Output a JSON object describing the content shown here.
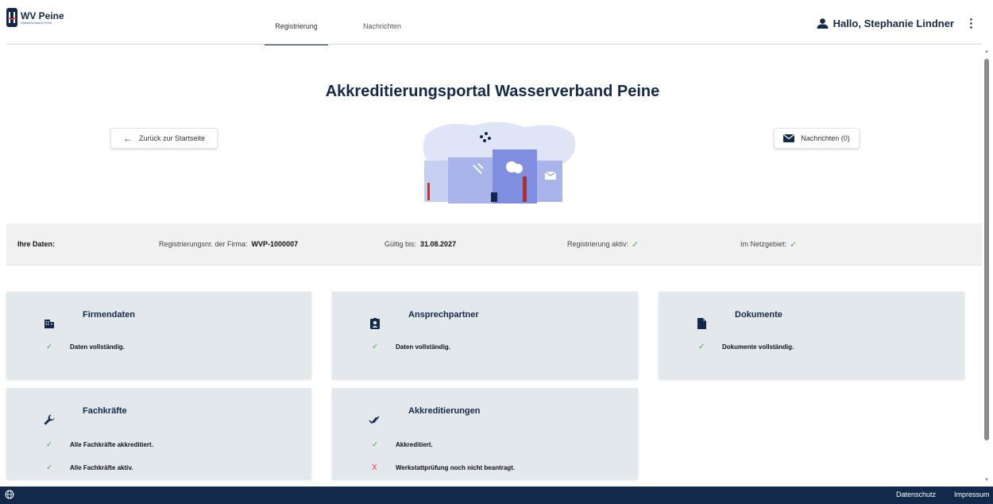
{
  "header": {
    "logo_title": "WV Peine",
    "logo_subtitle": "Wasserverband Peine",
    "tabs": [
      {
        "label": "Registrierung",
        "active": true
      },
      {
        "label": "Nachrichten",
        "active": false
      }
    ],
    "user_greeting": "Hallo, Stephanie Lindner"
  },
  "hero": {
    "title": "Akkreditierungsportal Wasserverband Peine",
    "back_button": "Zurück zur Startseite",
    "messages_button": "Nachrichten (0)"
  },
  "info": {
    "label": "Ihre Daten:",
    "reg_label": "Registrierungsnr. der Firma:",
    "reg_value": "WVP-1000007",
    "valid_label": "Gültig bis:",
    "valid_value": "31.08.2027",
    "active_label": "Registrierung aktiv:",
    "network_label": "Im Netzgebiet:",
    "check": "✓"
  },
  "cards": {
    "firmendaten": {
      "title": "Firmendaten",
      "rows": [
        "Daten vollständig."
      ]
    },
    "ansprechpartner": {
      "title": "Ansprechpartner",
      "rows": [
        "Daten vollständig."
      ]
    },
    "dokumente": {
      "title": "Dokumente",
      "rows": [
        "Dokumente vollständig."
      ]
    },
    "fachkraefte": {
      "title": "Fachkräfte",
      "rows": [
        "Alle Fachkräfte akkreditiert.",
        "Alle Fachkräfte aktiv."
      ]
    },
    "akkreditierungen": {
      "title": "Akkreditierungen",
      "rows": [
        "Akkreditiert.",
        "Werkstattprüfung noch nicht beantragt."
      ]
    }
  },
  "marks": {
    "ok": "✓",
    "fail": "X"
  },
  "footer": {
    "privacy": "Datenschutz",
    "imprint": "Impressum"
  },
  "colors": {
    "brand": "#13294b",
    "ok": "#4caf50",
    "fail": "#e53935",
    "card_bg": "#e3e8ed"
  },
  "icons": [
    "logo-icon",
    "user-icon",
    "kebab-menu-icon",
    "arrow-left-icon",
    "mail-icon",
    "building-icon",
    "contact-badge-icon",
    "document-icon",
    "wrench-icon",
    "double-check-icon",
    "globe-icon"
  ]
}
